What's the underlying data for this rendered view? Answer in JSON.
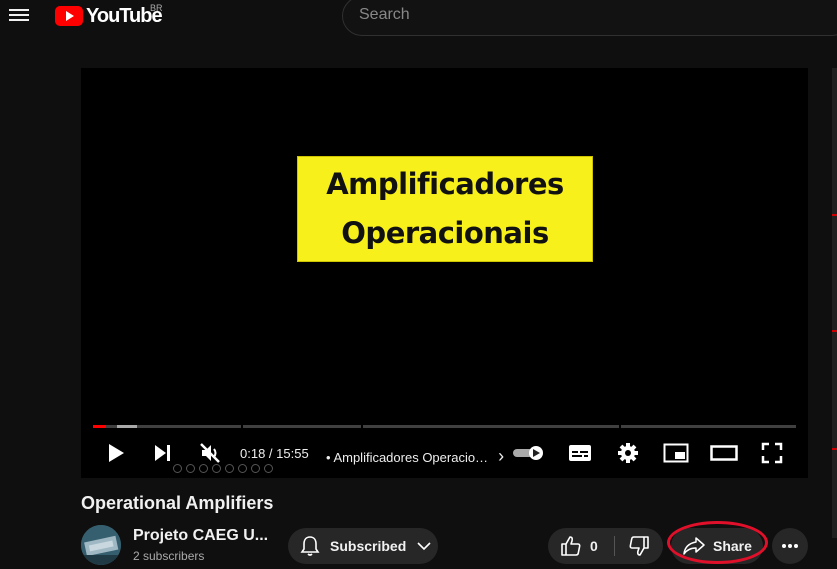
{
  "header": {
    "menu_icon": "hamburger-menu-icon",
    "logo_text": "YouTube",
    "country_code": "BR",
    "search_placeholder": "Search",
    "brand_color": "#ff0000"
  },
  "player": {
    "slide_line1": "Amplificadores",
    "slide_line2": "Operacionais",
    "slide_color": "#f7f01b",
    "current_time": "0:18",
    "duration": "15:55",
    "time_display": "0:18 / 15:55",
    "chapter_title": "• Amplificadores Operacio…",
    "chapter_chevron": "›",
    "progress_fraction": 0.019,
    "controls": [
      "play-icon",
      "next-icon",
      "mute-icon",
      "autoplay-toggle",
      "subtitles-icon",
      "settings-icon",
      "miniplayer-icon",
      "theater-icon",
      "fullscreen-icon"
    ]
  },
  "video": {
    "title": "Operational Amplifiers"
  },
  "channel": {
    "name": "Projeto CAEG U...",
    "subscribers": "2 subscribers",
    "subscribe_label": "Subscribed"
  },
  "actions": {
    "like_count": "0",
    "share_label": "Share",
    "more_icon": "more-horizontal-icon",
    "highlight_color": "#e0102a"
  }
}
